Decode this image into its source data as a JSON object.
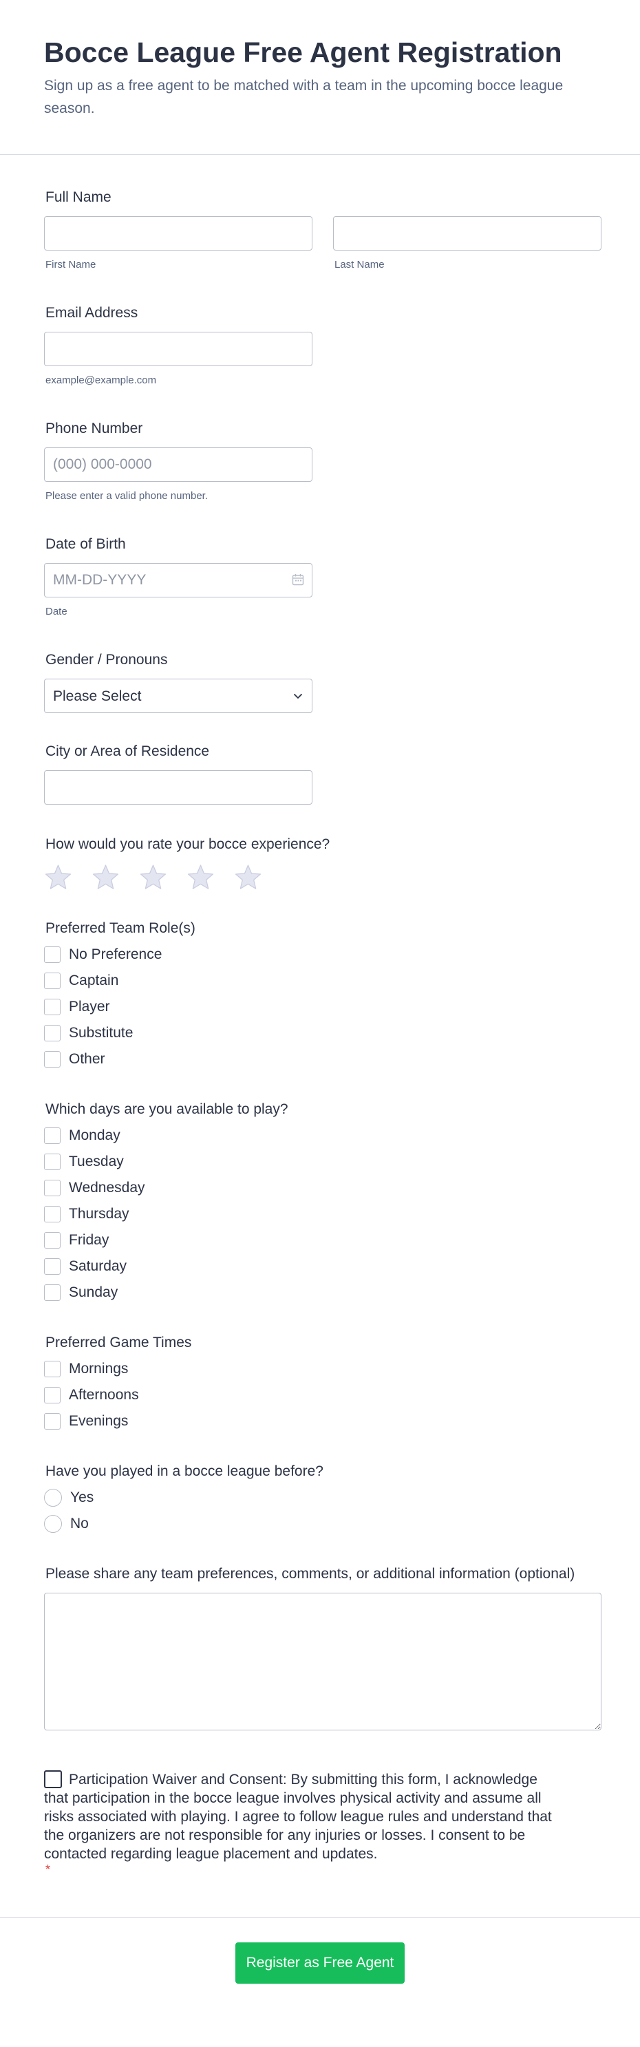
{
  "header": {
    "title": "Bocce League Free Agent Registration",
    "subtitle": "Sign up as a free agent to be matched with a team in the upcoming bocce league season."
  },
  "full_name": {
    "label": "Full Name",
    "first_sublabel": "First Name",
    "last_sublabel": "Last Name",
    "first_value": "",
    "last_value": ""
  },
  "email": {
    "label": "Email Address",
    "sublabel": "example@example.com",
    "value": ""
  },
  "phone": {
    "label": "Phone Number",
    "placeholder": "(000) 000-0000",
    "sublabel": "Please enter a valid phone number."
  },
  "dob": {
    "label": "Date of Birth",
    "placeholder": "MM-DD-YYYY",
    "sublabel": "Date",
    "icon": "calendar-icon"
  },
  "gender": {
    "label": "Gender / Pronouns",
    "selected": "Please Select",
    "icon": "chevron-down-icon"
  },
  "city": {
    "label": "City or Area of Residence",
    "value": ""
  },
  "rating": {
    "label": "How would you rate your bocce experience?",
    "max": 5,
    "value": 0,
    "star_color": "#e3e5f0",
    "star_stroke": "#c9cce0"
  },
  "team_roles": {
    "label": "Preferred Team Role(s)",
    "options": [
      "No Preference",
      "Captain",
      "Player",
      "Substitute",
      "Other"
    ]
  },
  "days": {
    "label": "Which days are you available to play?",
    "options": [
      "Monday",
      "Tuesday",
      "Wednesday",
      "Thursday",
      "Friday",
      "Saturday",
      "Sunday"
    ]
  },
  "times": {
    "label": "Preferred Game Times",
    "options": [
      "Mornings",
      "Afternoons",
      "Evenings"
    ]
  },
  "played_before": {
    "label": "Have you played in a bocce league before?",
    "options": [
      "Yes",
      "No"
    ]
  },
  "comments": {
    "label": "Please share any team preferences, comments, or additional information (optional)",
    "value": ""
  },
  "waiver": {
    "text": "Participation Waiver and Consent: By submitting this form, I acknowledge that participation in the bocce league involves physical activity and assume all risks associated with playing. I agree to follow league rules and understand that the organizers are not responsible for any injuries or losses. I consent to be contacted regarding league placement and updates.",
    "required_mark": "*"
  },
  "submit": {
    "label": "Register as Free Agent",
    "color": "#18bd5b"
  }
}
